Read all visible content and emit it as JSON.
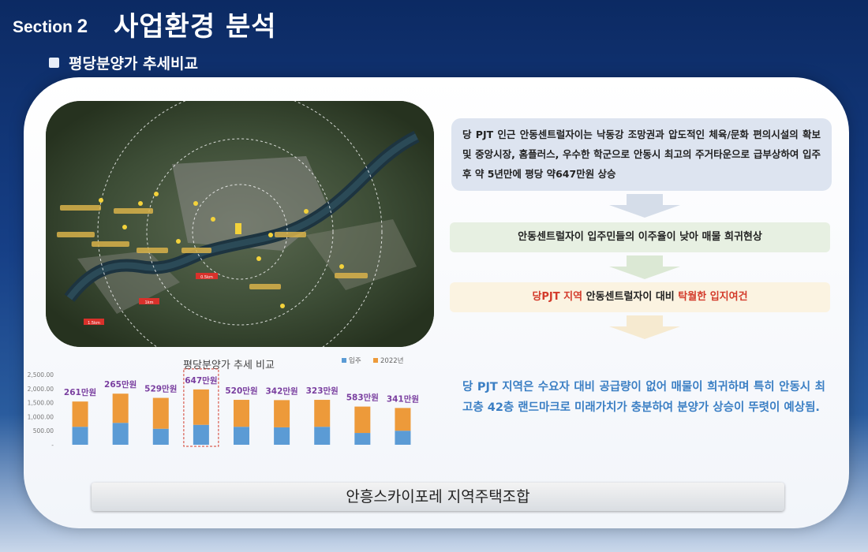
{
  "header": {
    "section_word": "Section",
    "section_number": "2",
    "title": "사업환경 분석",
    "subtitle": "평당분양가 추세비교"
  },
  "map": {
    "labels": [
      "0.5km",
      "1km",
      "1.5km"
    ]
  },
  "info_box": {
    "text": "당 PJT 인근 안동센트럴자이는 낙동강 조망권과 압도적인 체육/문화 편의시설의 확보 및 중앙시장, 홈플러스, 우수한 학군으로 안동시 최고의 주거타운으로 급부상하여 입주 후 약 5년만에 평당 약647만원 상승"
  },
  "step1": {
    "text": "안동센트럴자이 입주민들의 이주율이 낮아 매물 희귀현상"
  },
  "step2": {
    "part1": "당PJT 지역",
    "part2": " 안동센트럴자이 대비 ",
    "part3": "탁월한 입지여건"
  },
  "conclusion": {
    "text": "당 PJT 지역은 수요자 대비 공급량이 없어 매물이 희귀하며 특히 안동시 최고층 42층 랜드마크로 미래가치가 충분하여 분양가 상승이 뚜렷이 예상됨."
  },
  "chart_data": {
    "type": "bar",
    "title": "평당분양가 추세 비교",
    "stacked": true,
    "ylim": [
      0,
      2500
    ],
    "yticks": [
      "2,500.00",
      "2,000.00",
      "1,500.00",
      "1,000.00",
      "500.00",
      "-"
    ],
    "series": [
      {
        "name": "입주",
        "color": "#5b9bd5",
        "values": [
          640,
          780,
          570,
          710,
          640,
          620,
          640,
          420,
          500
        ]
      },
      {
        "name": "2022년",
        "color": "#ed9a3a",
        "values": [
          900,
          1040,
          1100,
          1260,
          960,
          970,
          960,
          940,
          810
        ]
      }
    ],
    "data_labels": [
      "261만원",
      "265만원",
      "529만원",
      "647만원",
      "520만원",
      "342만원",
      "323만원",
      "583만원",
      "341만원"
    ],
    "highlight_index": 3
  },
  "footer": {
    "text": "안흥스카이포레 지역주택조합"
  },
  "colors": {
    "label_purple": "#7a3fa0",
    "highlight_red": "#d33a2a",
    "conclusion_blue": "#3b7fc4"
  }
}
